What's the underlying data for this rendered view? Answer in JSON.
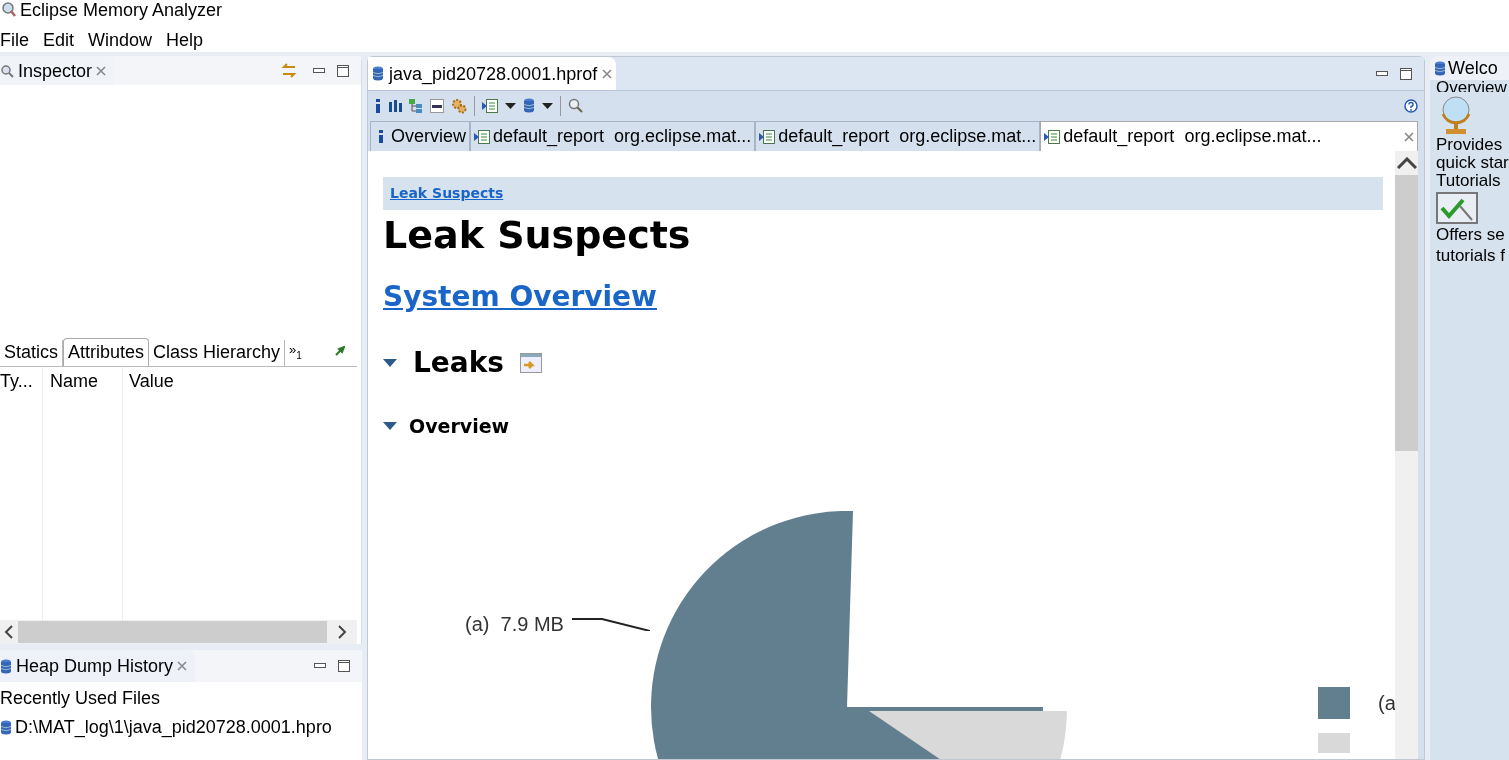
{
  "window": {
    "title": "Eclipse Memory Analyzer"
  },
  "menu": [
    "File",
    "Edit",
    "Window",
    "Help"
  ],
  "inspector": {
    "title": "Inspector",
    "tabs": [
      {
        "label": "Statics",
        "selected": false
      },
      {
        "label": "Attributes",
        "selected": true
      },
      {
        "label": "Class Hierarchy",
        "selected": false
      }
    ],
    "overflow": "»",
    "overflow_count": "1",
    "columns": [
      "Ty...",
      "Name",
      "Value"
    ]
  },
  "heap_dump_history": {
    "title": "Heap Dump History",
    "section": "Recently Used Files",
    "files": [
      "D:\\MAT_log\\1\\java_pid20728.0001.hpro"
    ]
  },
  "editor": {
    "tab_title": "java_pid20728.0001.hprof",
    "inner_tabs": [
      {
        "kind": "info",
        "label": "Overview",
        "selected": false
      },
      {
        "kind": "report",
        "label": "default_report  org.eclipse.mat...",
        "selected": false
      },
      {
        "kind": "report",
        "label": "default_report  org.eclipse.mat...",
        "selected": false
      },
      {
        "kind": "report",
        "label": "default_report  org.eclipse.mat...",
        "selected": true
      }
    ],
    "breadcrumb": "Leak Suspects",
    "heading": "Leak Suspects",
    "link": "System Overview",
    "sections": [
      {
        "kind": "h2",
        "label": "Leaks",
        "expanded": true
      },
      {
        "kind": "h3",
        "label": "Overview",
        "expanded": true
      }
    ],
    "chart_label": "(a)  7.9 MB",
    "legend_label": "(a"
  },
  "welcome": {
    "title": "Welco",
    "lines": [
      "Overview",
      "Provides",
      "quick star",
      "Tutorials",
      "Offers se",
      "tutorials f"
    ]
  }
}
